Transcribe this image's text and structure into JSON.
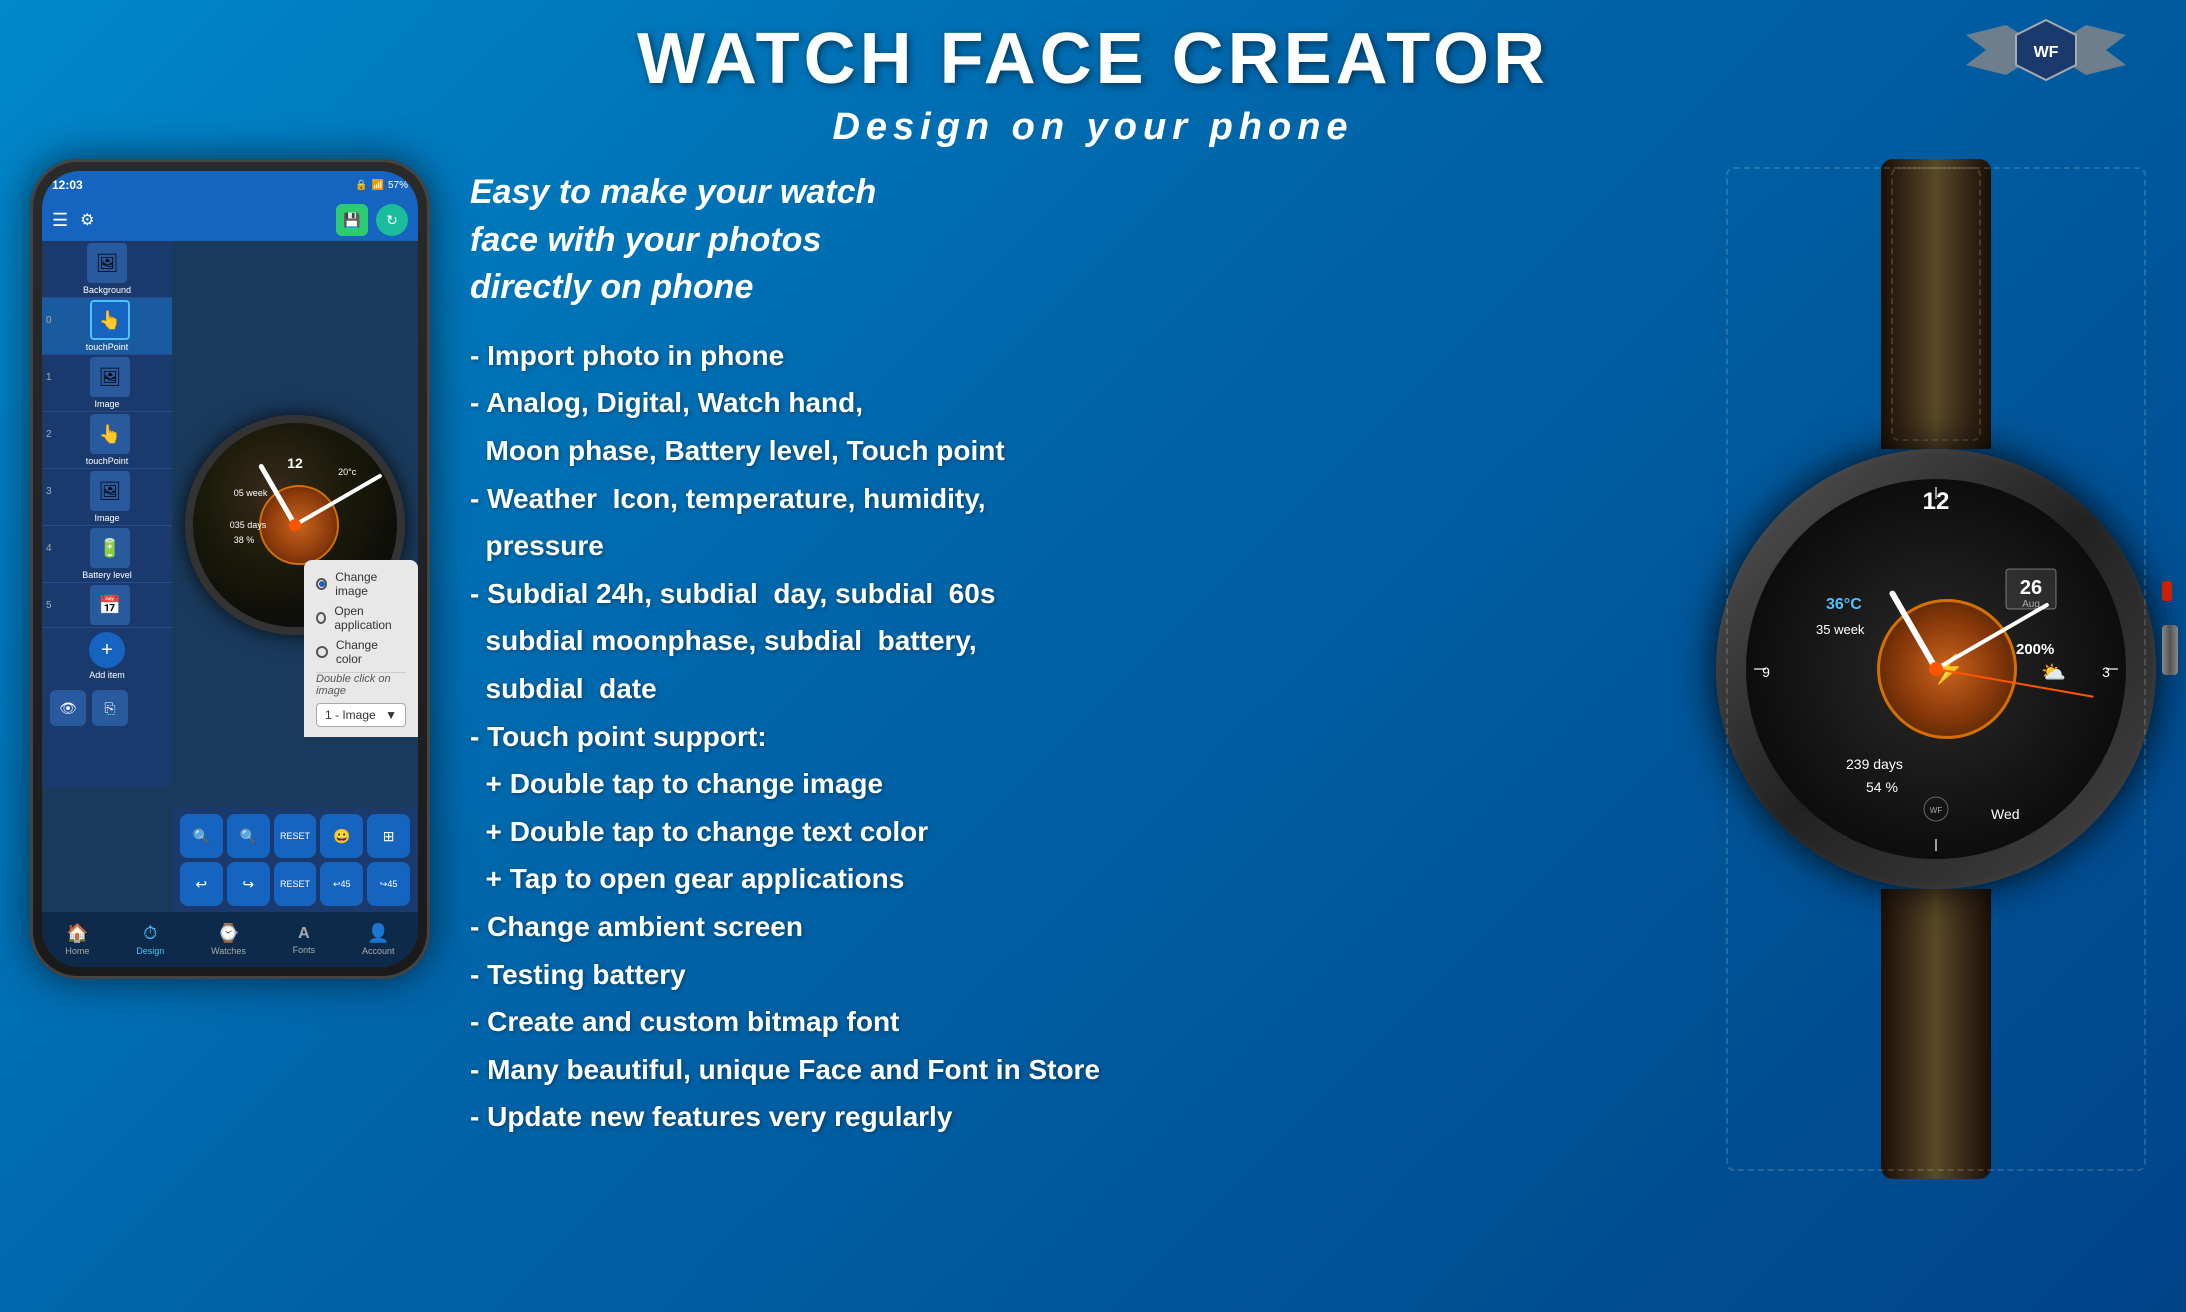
{
  "app": {
    "title": "WATCH FACE CREATOR",
    "subtitle": "Design on your phone",
    "logo_text": "WF"
  },
  "intro": {
    "line1": "Easy to make your watch",
    "line2": "face with your photos",
    "line3": "directly on phone"
  },
  "features": [
    "- Import photo in phone",
    "- Analog, Digital, Watch hand,",
    "  Moon phase, Battery level, Touch point",
    "- Weather  Icon, temperature, humidity,",
    "  pressure",
    "- Subdial 24h, subdial  day, subdial  60s",
    "  subdial moonphase, subdial  battery,",
    "  subdial  date",
    "- Touch point support:",
    "  + Double tap to change image",
    "  + Double tap to change text color",
    "  + Tap to open gear applications",
    "- Change ambient screen",
    "- Testing battery",
    "- Create and custom bitmap font",
    "- Many beautiful, unique Face and Font in Store",
    "- Update new features very regularly"
  ],
  "phone": {
    "status_time": "12:03",
    "battery": "57%",
    "layers": [
      {
        "number": "",
        "icon": "🖼",
        "label": "Background",
        "selected": false
      },
      {
        "number": "0",
        "icon": "👆",
        "label": "touchPoint",
        "selected": true
      },
      {
        "number": "1",
        "icon": "🖼",
        "label": "Image",
        "selected": false
      },
      {
        "number": "2",
        "icon": "👆",
        "label": "touchPoint",
        "selected": false
      },
      {
        "number": "3",
        "icon": "🖼",
        "label": "Image",
        "selected": false
      },
      {
        "number": "4",
        "icon": "🔋",
        "label": "Battery level",
        "selected": false
      },
      {
        "number": "5",
        "icon": "📅",
        "label": "",
        "selected": false
      }
    ],
    "popup": {
      "options": [
        {
          "label": "Change image",
          "selected": true
        },
        {
          "label": "Open application",
          "selected": false
        },
        {
          "label": "Change color",
          "selected": false
        }
      ],
      "hint": "Double click on image",
      "dropdown_value": "1 - Image"
    },
    "nav_items": [
      {
        "icon": "🏠",
        "label": "Home",
        "active": false
      },
      {
        "icon": "⏱",
        "label": "Design",
        "active": true
      },
      {
        "icon": "⌚",
        "label": "Watches",
        "active": false
      },
      {
        "icon": "A",
        "label": "Fonts",
        "active": false
      },
      {
        "icon": "👤",
        "label": "Account",
        "active": false
      }
    ]
  },
  "watch_face": {
    "time_12": "12",
    "date_num": "26",
    "month": "Aug",
    "temperature": "36°C",
    "week": "35 week",
    "days": "239 days",
    "percent": "54 %",
    "day_name": "Wed"
  },
  "colors": {
    "bg_gradient_start": "#0088cc",
    "bg_gradient_end": "#004488",
    "accent_blue": "#1565c0",
    "accent_orange": "#c8641e",
    "accent_red": "#cc2200",
    "title_color": "#ffffff"
  }
}
